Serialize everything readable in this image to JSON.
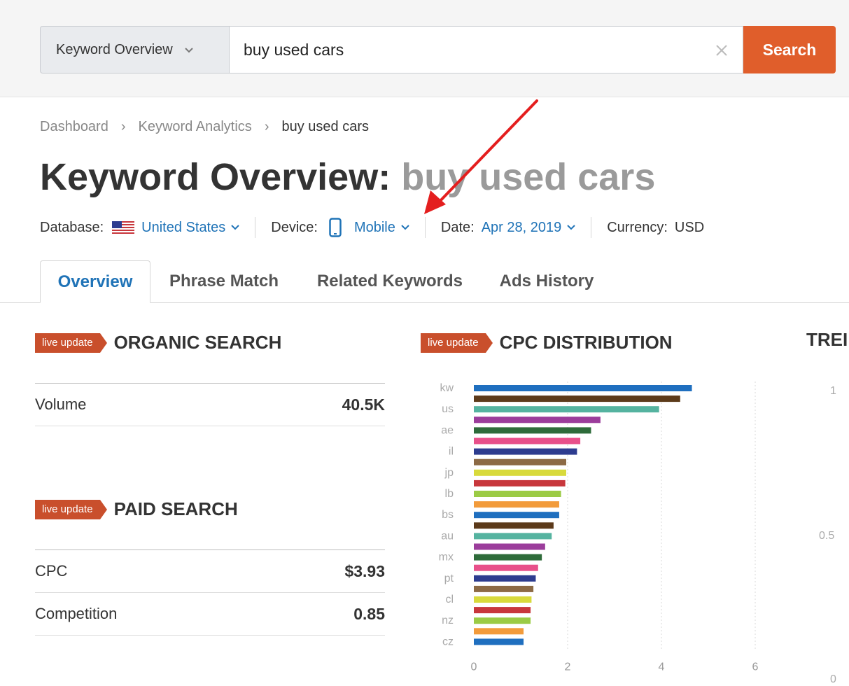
{
  "search": {
    "mode_label": "Keyword Overview",
    "query": "buy used cars",
    "button_label": "Search"
  },
  "breadcrumb": {
    "items": [
      "Dashboard",
      "Keyword Analytics",
      "buy used cars"
    ]
  },
  "title": {
    "prefix": "Keyword Overview: ",
    "keyword": "buy used cars"
  },
  "meta": {
    "database_label": "Database:",
    "database_value": "United States",
    "device_label": "Device:",
    "device_value": "Mobile",
    "date_label": "Date:",
    "date_value": "Apr 28, 2019",
    "currency_label": "Currency:",
    "currency_value": "USD"
  },
  "tabs": [
    {
      "label": "Overview",
      "active": true
    },
    {
      "label": "Phrase Match",
      "active": false
    },
    {
      "label": "Related Keywords",
      "active": false
    },
    {
      "label": "Ads History",
      "active": false
    }
  ],
  "organic": {
    "badge": "live update",
    "title": "ORGANIC SEARCH",
    "rows": [
      {
        "label": "Volume",
        "value": "40.5K"
      }
    ]
  },
  "paid": {
    "badge": "live update",
    "title": "PAID SEARCH",
    "rows": [
      {
        "label": "CPC",
        "value": "$3.93"
      },
      {
        "label": "Competition",
        "value": "0.85"
      }
    ]
  },
  "cpc": {
    "badge": "live update",
    "title": "CPC DISTRIBUTION"
  },
  "trend": {
    "title": "TREI",
    "ticks": [
      "1",
      "0.5",
      "0"
    ]
  },
  "chart_data": {
    "type": "bar",
    "orientation": "horizontal",
    "title": "CPC DISTRIBUTION",
    "labeled_categories": [
      "kw",
      "us",
      "ae",
      "il",
      "jp",
      "lb",
      "bs",
      "au",
      "mx",
      "pt",
      "cl",
      "nz",
      "cz"
    ],
    "values": [
      4.65,
      4.4,
      3.95,
      2.7,
      2.5,
      2.27,
      2.2,
      1.97,
      1.97,
      1.95,
      1.86,
      1.82,
      1.82,
      1.7,
      1.66,
      1.52,
      1.45,
      1.37,
      1.32,
      1.27,
      1.23,
      1.21,
      1.21,
      1.06,
      1.06
    ],
    "colors": [
      "#1f6fbf",
      "#5c3a1a",
      "#55b3a0",
      "#9b3d9b",
      "#2e6b3a",
      "#e8508a",
      "#2d3c8f",
      "#8c6a45",
      "#d8da3c",
      "#c8373c",
      "#9bcb45",
      "#f29b3b",
      "#1f6fbf",
      "#5c3a1a",
      "#55b3a0",
      "#9b3d9b",
      "#2e6b3a",
      "#e8508a",
      "#2d3c8f",
      "#8c6a45",
      "#d8da3c",
      "#c8373c",
      "#9bcb45",
      "#f29b3b",
      "#1f6fbf"
    ],
    "xlim": [
      0,
      6
    ],
    "xticks": [
      "0",
      "2",
      "4",
      "6"
    ],
    "grid": true
  }
}
